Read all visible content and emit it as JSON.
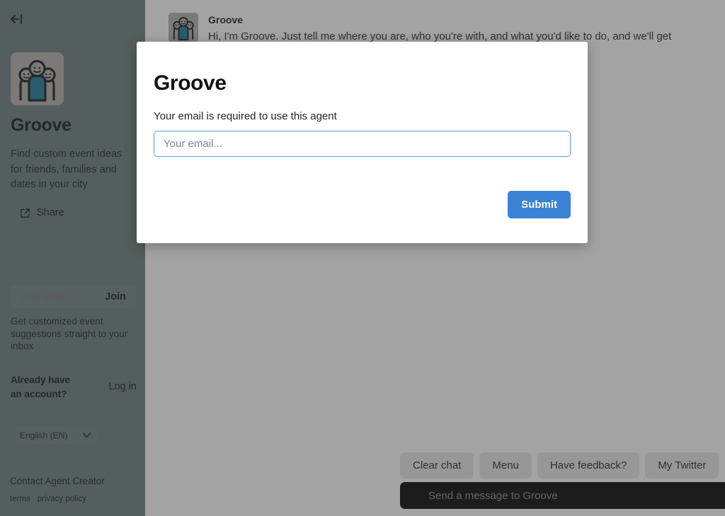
{
  "sidebar": {
    "collapse_icon": "arrow-left-to-line-icon",
    "agent_name": "Groove",
    "agent_description": "Find custom event ideas for friends, families and dates in your city",
    "share_label": "Share",
    "share_icon": "external-link-icon",
    "newsletter": {
      "email_placeholder": "Your email....",
      "email_value": "",
      "join_label": "Join",
      "note": "Get customized event suggestions straight to your inbox"
    },
    "account": {
      "question": "Already have an account?",
      "login_label": "Log in"
    },
    "language": {
      "selected": "English (EN)",
      "chevron_icon": "chevron-down-icon"
    },
    "contact_label": "Contact Agent Creator",
    "legal": [
      "terms",
      "privacy policy"
    ]
  },
  "chat": {
    "message": {
      "sender": "Groove",
      "avatar_icon": "three-people-avatar-icon",
      "text": "Hi, I'm Groove. Just tell me where you are, who you're with, and what you'd like to do, and we'll get"
    },
    "quick_actions": [
      "Clear chat",
      "Menu",
      "Have feedback?",
      "My Twitter"
    ],
    "composer": {
      "placeholder": "Send a message to Groove",
      "value": "",
      "send_icon": "send-paper-plane-icon"
    }
  },
  "modal": {
    "title": "Groove",
    "subtitle": "Your email is required to use this agent",
    "email_placeholder": "Your email...",
    "email_value": "",
    "submit_label": "Submit"
  },
  "colors": {
    "sidebar_bg": "#6b7d7e",
    "submit_blue": "#3b82d4",
    "input_focus_border": "#5b9bd5",
    "composer_bg": "#000000",
    "avatar_shirt": "#1b7a96"
  }
}
